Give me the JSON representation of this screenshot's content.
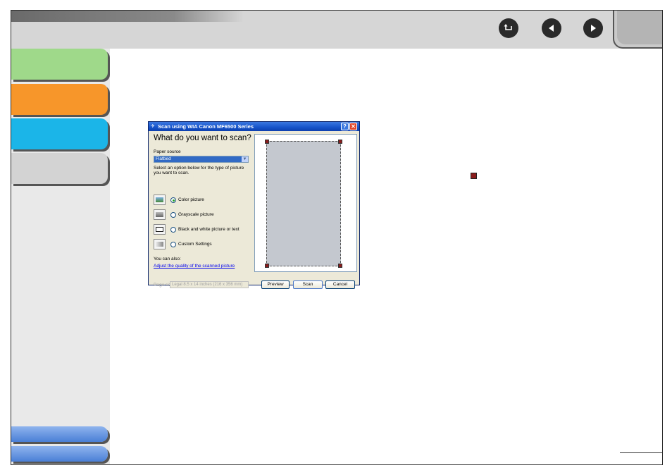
{
  "dialog": {
    "title": "Scan using WIA Canon MF6500 Series",
    "help_icon": "?",
    "close_icon": "✕",
    "heading": "What do you want to scan?",
    "paper_source_label": "Paper source",
    "paper_source_value": "Flatbed",
    "select_option_text": "Select an option below for the type of picture you want to scan.",
    "options": [
      {
        "label": "Color picture",
        "checked": true
      },
      {
        "label": "Grayscale picture",
        "checked": false
      },
      {
        "label": "Black and white picture or text",
        "checked": false
      },
      {
        "label": "Custom Settings",
        "checked": false
      }
    ],
    "also_label": "You can also:",
    "adjust_link": "Adjust the quality of the scanned picture",
    "page_size_label": "Page size:",
    "page_size_value": "Legal 8.5 x 14 inches (216 x 356 mm)",
    "buttons": {
      "preview": "Preview",
      "scan": "Scan",
      "cancel": "Cancel"
    }
  },
  "colors": {
    "tab_green": "#9fd98a",
    "tab_orange": "#f7962a",
    "tab_cyan": "#1bb5e8",
    "tab_gray": "#d3d3d3",
    "tab_blue": "#4a7fd6",
    "marker_red": "#8a1c1c"
  },
  "icons": {
    "back": "return-arrow-icon",
    "prev": "left-triangle-icon",
    "next": "right-triangle-icon"
  }
}
